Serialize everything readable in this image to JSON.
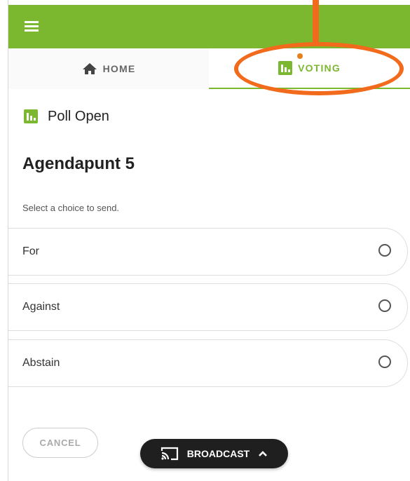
{
  "colors": {
    "accent": "#7cb82f",
    "annotation": "#f26a1b",
    "notification_dot": "#e8801a",
    "broadcast_bg": "#1f1f1f"
  },
  "header": {
    "menu_icon": "hamburger-menu-icon"
  },
  "tabs": [
    {
      "label": "HOME",
      "icon": "home-icon",
      "active": false
    },
    {
      "label": "VOTING",
      "icon": "bar-chart-icon",
      "active": true
    }
  ],
  "poll": {
    "status": "Poll Open",
    "status_icon": "bar-chart-icon",
    "title": "Agendapunt 5",
    "instruction": "Select a choice to send.",
    "choices": [
      {
        "label": "For",
        "selected": false
      },
      {
        "label": "Against",
        "selected": false
      },
      {
        "label": "Abstain",
        "selected": false
      }
    ]
  },
  "actions": {
    "cancel_label": "CANCEL",
    "broadcast_label": "BROADCAST",
    "broadcast_icon": "cast-icon",
    "broadcast_chevron": "chevron-up-icon"
  }
}
